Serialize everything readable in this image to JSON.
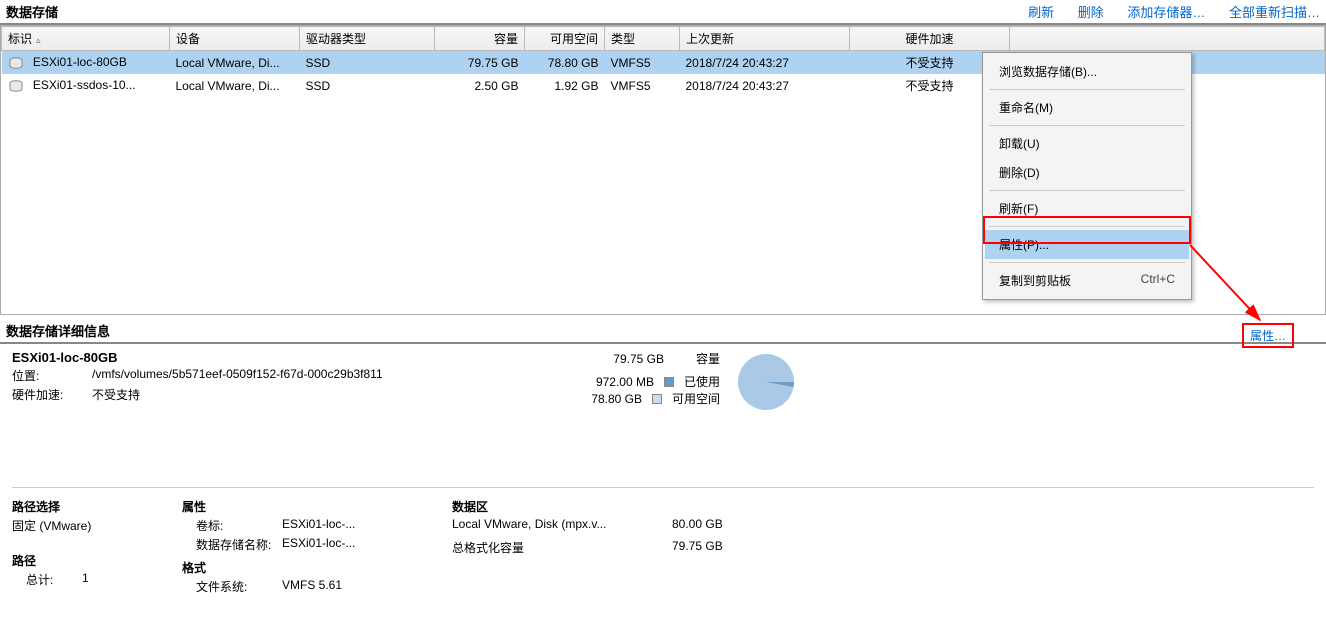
{
  "section_title": "数据存储",
  "toolbar_links": {
    "refresh": "刷新",
    "delete": "删除",
    "add_storage": "添加存储器…",
    "rescan_all": "全部重新扫描…"
  },
  "columns": {
    "id": "标识",
    "device": "设备",
    "drive_type": "驱动器类型",
    "capacity": "容量",
    "free": "可用空间",
    "type": "类型",
    "last_update": "上次更新",
    "hw_accel": "硬件加速"
  },
  "rows": [
    {
      "id": "ESXi01-loc-80GB",
      "device": "Local VMware, Di...",
      "drive_type": "SSD",
      "capacity": "79.75 GB",
      "free": "78.80 GB",
      "type": "VMFS5",
      "last_update": "2018/7/24 20:43:27",
      "hw_accel": "不受支持"
    },
    {
      "id": "ESXi01-ssdos-10...",
      "device": "Local VMware, Di...",
      "drive_type": "SSD",
      "capacity": "2.50 GB",
      "free": "1.92 GB",
      "type": "VMFS5",
      "last_update": "2018/7/24 20:43:27",
      "hw_accel": "不受支持"
    }
  ],
  "context_menu": {
    "browse": "浏览数据存储(B)...",
    "rename": "重命名(M)",
    "unmount": "卸载(U)",
    "delete": "删除(D)",
    "refresh": "刷新(F)",
    "properties": "属性(P)...",
    "copy_clip": "复制到剪贴板",
    "copy_shortcut": "Ctrl+C"
  },
  "details": {
    "title": "数据存储详细信息",
    "properties_link": "属性…",
    "name": "ESXi01-loc-80GB",
    "location_label": "位置:",
    "location_value": "/vmfs/volumes/5b571eef-0509f152-f67d-000c29b3f811",
    "hw_accel_label": "硬件加速:",
    "hw_accel_value": "不受支持",
    "capacity_label": "容量",
    "capacity_value": "79.75 GB",
    "used_label": "已使用",
    "used_value": "972.00 MB",
    "free_label": "可用空间",
    "free_value": "78.80 GB"
  },
  "bottom": {
    "path_select_h": "路径选择",
    "path_select_v": "固定 (VMware)",
    "paths_h": "路径",
    "total_label": "总计:",
    "total_value": "1",
    "attr_h": "属性",
    "vol_label": "卷标:",
    "vol_value": "ESXi01-loc-...",
    "dsname_label": "数据存储名称:",
    "dsname_value": "ESXi01-loc-...",
    "format_h": "格式",
    "fs_label": "文件系统:",
    "fs_value": "VMFS 5.61",
    "extent_h": "数据区",
    "extent_name": "Local VMware, Disk (mpx.v...",
    "extent_size": "80.00 GB",
    "fmt_cap_label": "总格式化容量",
    "fmt_cap_value": "79.75 GB"
  }
}
